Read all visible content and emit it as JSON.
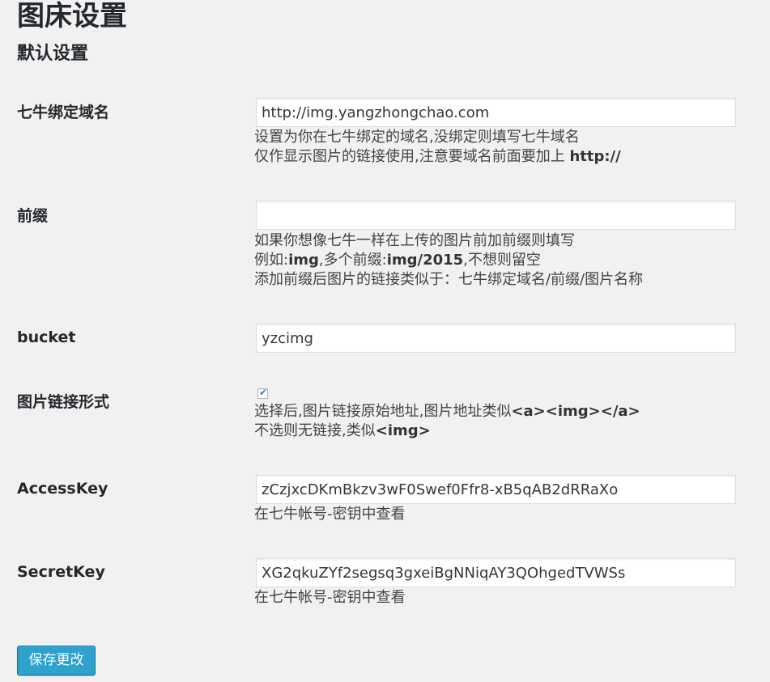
{
  "page": {
    "title": "图床设置",
    "section_title": "默认设置",
    "accent_color": "#2ea2cc"
  },
  "domain": {
    "label": "七牛绑定域名",
    "value": "http://img.yangzhongchao.com",
    "desc_line1": "设置为你在七牛绑定的域名,没绑定则填写七牛域名",
    "desc_line2_text": "仅作显示图片的链接使用,注意要域名前面要加上 ",
    "desc_line2_bold": "http://"
  },
  "prefix": {
    "label": "前缀",
    "value": "",
    "desc_line1": "如果你想像七牛一样在上传的图片前加前缀则填写",
    "desc_line2_a": "例如:",
    "desc_line2_b": "img",
    "desc_line2_c": ",多个前缀:",
    "desc_line2_d": "img/2015",
    "desc_line2_e": ",不想则留空",
    "desc_line3": "添加前缀后图片的链接类似于：七牛绑定域名/前缀/图片名称"
  },
  "bucket": {
    "label": "bucket",
    "value": "yzcimg"
  },
  "link_format": {
    "label": "图片链接形式",
    "checked": true,
    "check_glyph": "✔",
    "desc_line1_text": "选择后,图片链接原始地址,图片地址类似",
    "desc_line1_bold": "<a><img></a>",
    "desc_line2_text": "不选则无链接,类似",
    "desc_line2_bold": "<img>"
  },
  "access_key": {
    "label": "AccessKey",
    "value": "zCzjxcDKmBkzv3wF0Swef0Ffr8-xB5qAB2dRRaXo",
    "desc": "在七牛帐号-密钥中查看"
  },
  "secret_key": {
    "label": "SecretKey",
    "value": "XG2qkuZYf2segsq3gxeiBgNNiqAY3QOhgedTVWSs",
    "desc": "在七牛帐号-密钥中查看"
  },
  "submit": {
    "label": "保存更改"
  }
}
